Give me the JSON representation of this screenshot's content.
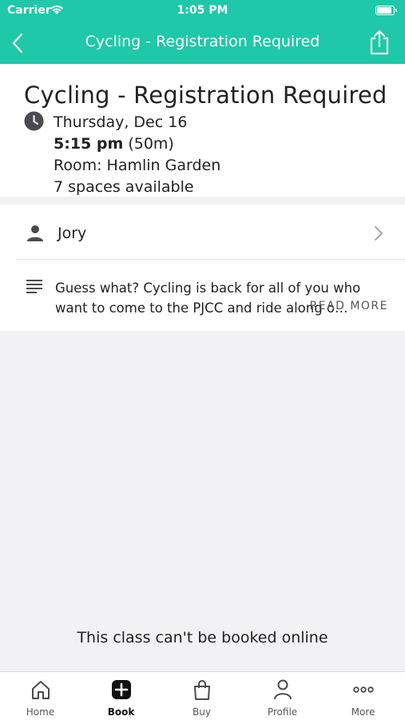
{
  "status_bar": {
    "carrier": "Carrier",
    "time": "1:05 PM"
  },
  "nav": {
    "title": "Cycling - Registration Required",
    "back_icon": "chevron-left-icon",
    "share_icon": "share-icon"
  },
  "class": {
    "title": "Cycling - Registration Required",
    "date": "Thursday, Dec 16",
    "time": "5:15 pm",
    "duration": "(50m)",
    "room": "Room: Hamlin Garden",
    "spaces": "7 spaces available"
  },
  "instructor": {
    "name": "Jory"
  },
  "description": {
    "text": "Guess what? Cycling is back for all of you who want to come to the PJCC and ride along o…",
    "read_more": "READ MORE"
  },
  "notice": "This class can't be booked online",
  "tabs": [
    {
      "label": "Home",
      "icon": "home-icon"
    },
    {
      "label": "Book",
      "icon": "book-plus-icon",
      "active": true
    },
    {
      "label": "Buy",
      "icon": "shopping-bag-icon"
    },
    {
      "label": "Profile",
      "icon": "profile-icon"
    },
    {
      "label": "More",
      "icon": "more-dots-icon"
    }
  ],
  "colors": {
    "accent": "#1ec8a8",
    "background": "#f2f2f4"
  }
}
